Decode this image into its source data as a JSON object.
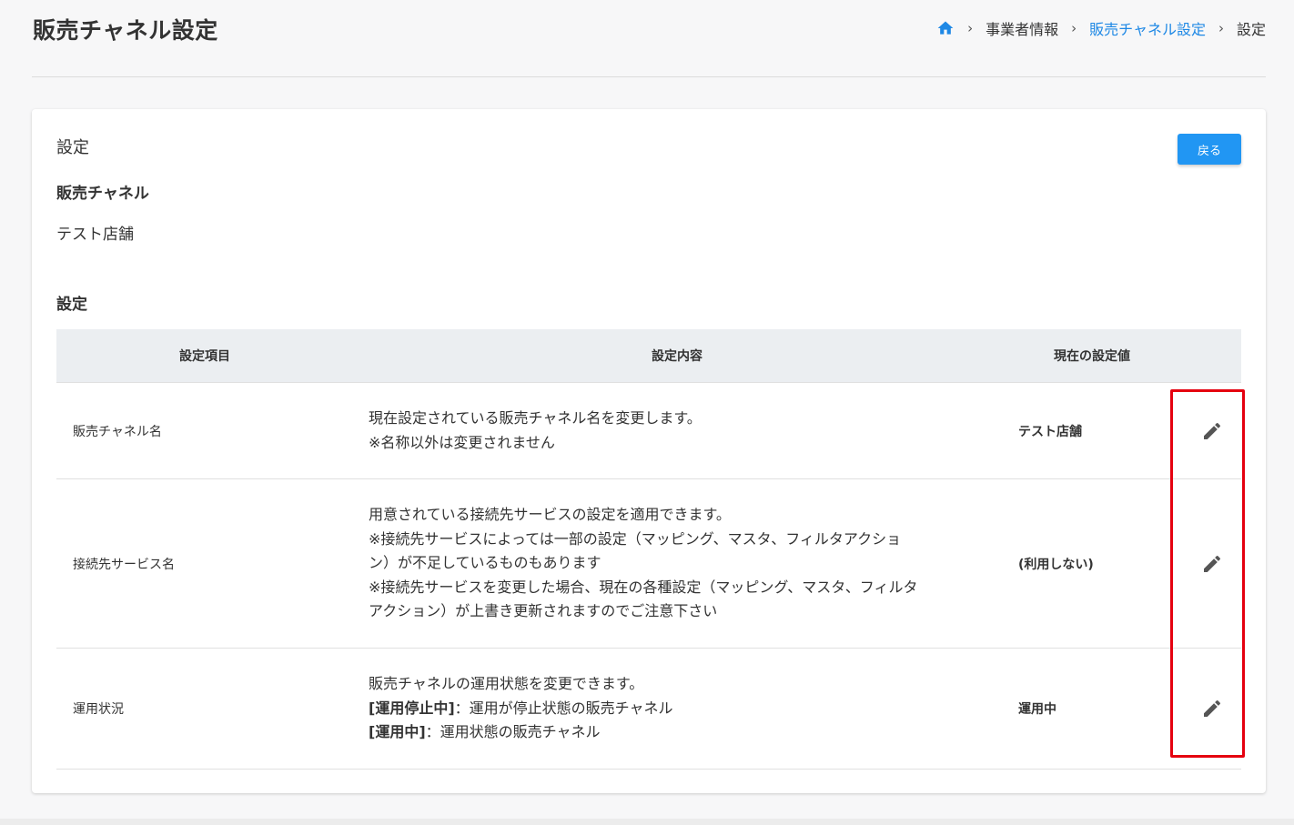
{
  "page": {
    "title": "販売チャネル設定"
  },
  "breadcrumb": {
    "items": [
      "事業者情報",
      "販売チャネル設定",
      "設定"
    ]
  },
  "card": {
    "title": "設定",
    "back_label": "戻る",
    "channel_label": "販売チャネル",
    "channel_value": "テスト店舗",
    "settings_label": "設定"
  },
  "table": {
    "headers": [
      "設定項目",
      "設定内容",
      "現在の設定値"
    ],
    "rows": [
      {
        "item": "販売チャネル名",
        "desc": [
          "現在設定されている販売チャネル名を変更します。",
          "※名称以外は変更されません"
        ],
        "value": "テスト店舗"
      },
      {
        "item": "接続先サービス名",
        "desc": [
          "用意されている接続先サービスの設定を適用できます。",
          "※接続先サービスによっては一部の設定（マッピング、マスタ、フィルタアクショ",
          "ン）が不足しているものもあります",
          "※接続先サービスを変更した場合、現在の各種設定（マッピング、マスタ、フィルタ",
          "アクション）が上書き更新されますのでご注意下さい"
        ],
        "value": "(利用しない)"
      },
      {
        "item": "運用状況",
        "desc": {
          "line1": "販売チャネルの運用状態を変更できます。",
          "line2_bold": "[運用停止中]",
          "line2_rest": "：運用が停止状態の販売チャネル",
          "line3_bold": "[運用中]",
          "line3_rest": "：運用状態の販売チャネル"
        },
        "value": "運用中"
      }
    ]
  },
  "colors": {
    "accent": "#2196f3",
    "link": "#1e88e5",
    "highlight": "#e5000f",
    "header_bg": "#ebeef1"
  },
  "icons": {
    "home": "home-icon",
    "separator": "chevron-right-icon",
    "edit": "pencil-icon"
  }
}
